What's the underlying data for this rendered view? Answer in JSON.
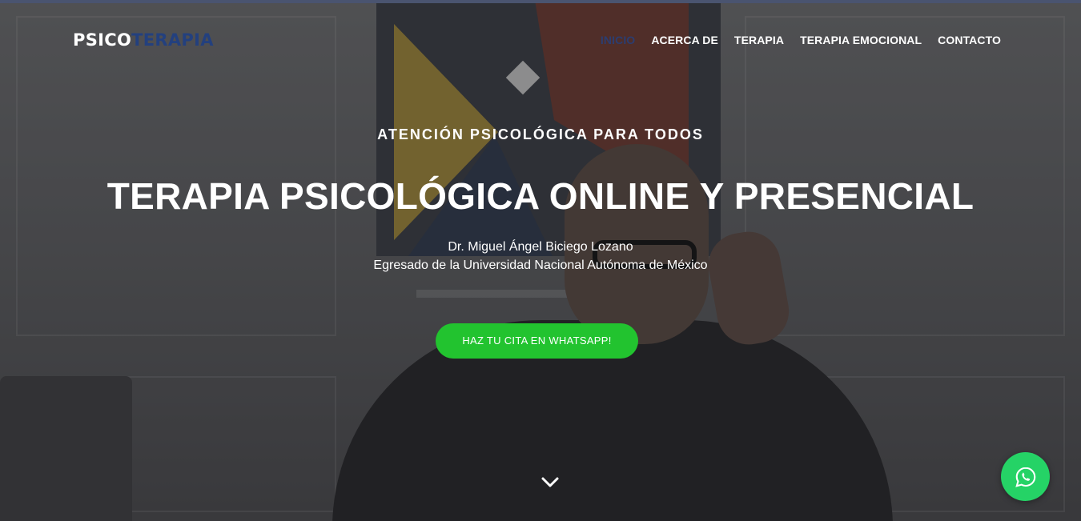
{
  "brand": {
    "part1": "PSICO",
    "part2": "TERAPIA",
    "colors": {
      "primary": "#23407e",
      "cta": "#22c32f",
      "whatsapp": "#25d366"
    }
  },
  "nav": {
    "items": [
      {
        "label": "INICIO",
        "active": true
      },
      {
        "label": "ACERCA DE",
        "active": false
      },
      {
        "label": "TERAPIA",
        "active": false
      },
      {
        "label": "TERAPIA EMOCIONAL",
        "active": false
      },
      {
        "label": "CONTACTO",
        "active": false
      }
    ]
  },
  "hero": {
    "eyebrow": "ATENCIÓN PSICOLÓGICA PARA TODOS",
    "headline": "TERAPIA PSICOLÓGICA ONLINE Y PRESENCIAL",
    "doctor_name": "Dr. Miguel Ángel Biciego Lozano",
    "doctor_university": "Egresado de la Universidad Nacional Autónoma de México",
    "cta_label": "HAZ TU CITA EN WHATSAPP!",
    "scroll_icon": "chevron-down-icon"
  },
  "floating": {
    "icon": "whatsapp-icon"
  }
}
